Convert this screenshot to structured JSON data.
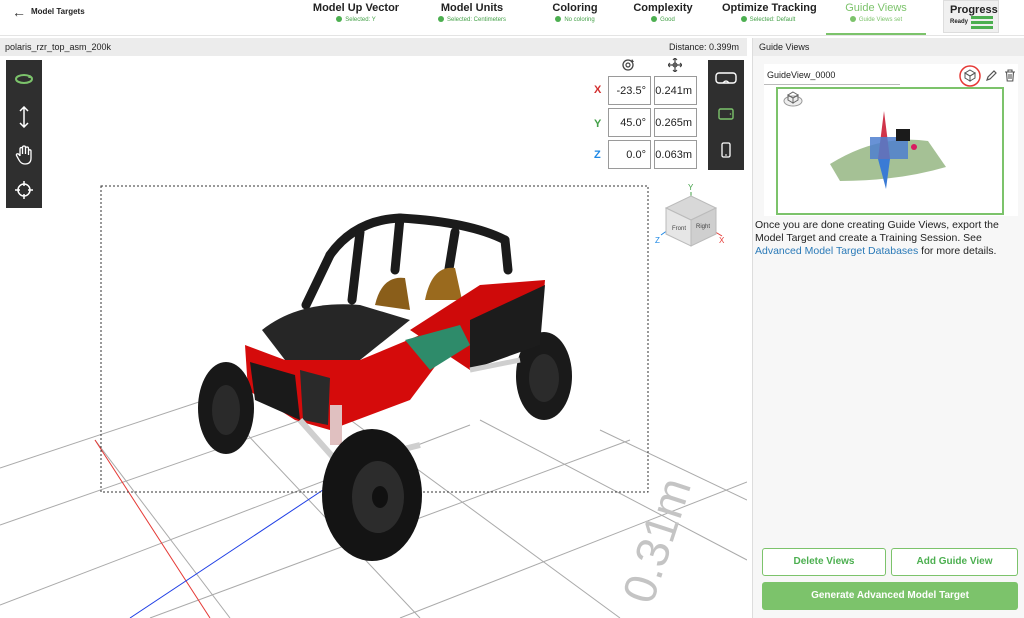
{
  "header": {
    "back_icon": "arrow-left-icon",
    "title": "Model Targets",
    "steps": [
      {
        "label": "Model Up Vector",
        "status": "Selected: Y"
      },
      {
        "label": "Model Units",
        "status": "Selected: Centimeters"
      },
      {
        "label": "Coloring",
        "status": "No coloring"
      },
      {
        "label": "Complexity",
        "status": "Good"
      },
      {
        "label": "Optimize Tracking",
        "status": "Selected: Default"
      },
      {
        "label": "Guide Views",
        "status": "Guide Views set"
      }
    ],
    "progress": {
      "label": "Progress",
      "status": "Ready"
    },
    "accent_color": "#7cc36b",
    "status_color": "#4caf50"
  },
  "viewport": {
    "model_name": "polaris_rzr_top_asm_200k",
    "distance": "Distance:  0.399m",
    "left_tools": [
      "orbit-icon",
      "vertical-move-icon",
      "pan-hand-icon",
      "crosshair-icon"
    ],
    "right_tools": [
      "headset-icon",
      "tablet-icon",
      "phone-icon"
    ],
    "rotation_icon": "rotate-icon",
    "position_icon": "move-arrows-icon",
    "transform": [
      {
        "axis": "X",
        "rotation": "-23.5°",
        "position": "0.241m",
        "color": "#d32f2f"
      },
      {
        "axis": "Y",
        "rotation": "45.0°",
        "position": "0.265m",
        "color": "#43a047"
      },
      {
        "axis": "Z",
        "rotation": "0.0°",
        "position": "0.063m",
        "color": "#1e88e5"
      }
    ],
    "nav_cube": {
      "y": "Y",
      "x": "X",
      "z": "Z",
      "front": "Front",
      "right": "Right"
    },
    "grid_label": "0.31m"
  },
  "panel": {
    "title": "Guide Views",
    "guide_view_name": "GuideView_0000",
    "card_icons": [
      "cube-view-icon",
      "pencil-icon",
      "trash-icon"
    ],
    "info_text_1": "Once you are done creating Guide Views, export the Model Target and create a Training Session. See ",
    "info_link": "Advanced Model Target Databases",
    "info_text_2": " for more details.",
    "delete_views": "Delete Views",
    "add_guide_view": "Add Guide View",
    "generate": "Generate Advanced Model Target"
  }
}
